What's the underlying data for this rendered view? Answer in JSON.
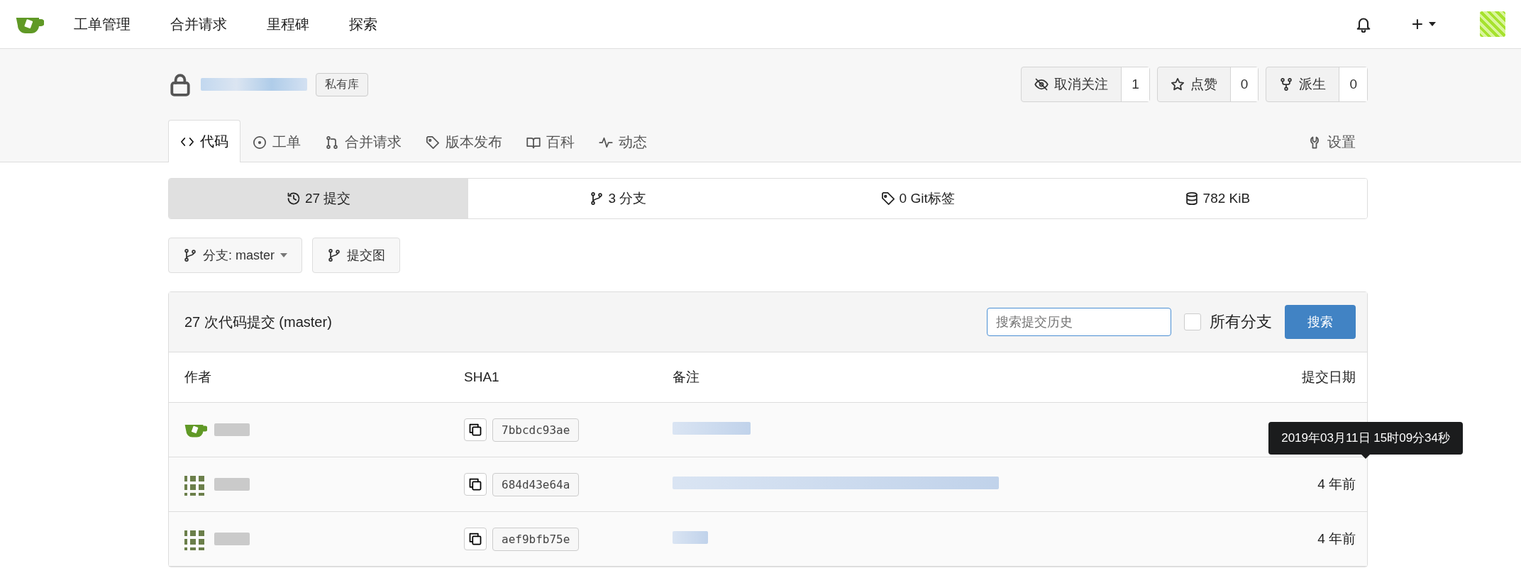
{
  "nav": {
    "items": [
      "工单管理",
      "合并请求",
      "里程碑",
      "探索"
    ],
    "plus": "+"
  },
  "repo": {
    "badge": "私有库",
    "actions": [
      {
        "kind": "watch",
        "label": "取消关注",
        "count": "1"
      },
      {
        "kind": "star",
        "label": "点赞",
        "count": "0"
      },
      {
        "kind": "fork",
        "label": "派生",
        "count": "0"
      }
    ]
  },
  "tabs": [
    {
      "kind": "code",
      "label": "代码",
      "selected": true
    },
    {
      "kind": "issue",
      "label": "工单",
      "selected": false
    },
    {
      "kind": "pr",
      "label": "合并请求",
      "selected": false
    },
    {
      "kind": "tag",
      "label": "版本发布",
      "selected": false
    },
    {
      "kind": "book",
      "label": "百科",
      "selected": false
    },
    {
      "kind": "pulse",
      "label": "动态",
      "selected": false
    }
  ],
  "settings_tab": {
    "label": "设置"
  },
  "stats": [
    {
      "kind": "history",
      "label": "27 提交",
      "selected": true
    },
    {
      "kind": "branch",
      "label": "3 分支",
      "selected": false
    },
    {
      "kind": "tag",
      "label": "0 Git标签",
      "selected": false
    },
    {
      "kind": "db",
      "label": "782 KiB",
      "selected": false
    }
  ],
  "branch_select": {
    "label": "分支: master"
  },
  "graph_button": {
    "label": "提交图"
  },
  "commits": {
    "title": "27 次代码提交 (master)",
    "search": {
      "placeholder": "搜索提交历史"
    },
    "all_branches": {
      "label": "所有分支",
      "checked": false
    },
    "search_button": "搜索",
    "columns": [
      "作者",
      "SHA1",
      "备注",
      "提交日期"
    ],
    "rows": [
      {
        "kind": "tea",
        "sha": "7bbcdc93ae"
      },
      {
        "kind": "pattern",
        "sha": "684d43e64a",
        "date": "4 年前"
      },
      {
        "kind": "pattern",
        "sha": "aef9bfb75e",
        "date": "4 年前"
      }
    ],
    "tooltip": "2019年03月11日 15时09分34秒"
  }
}
